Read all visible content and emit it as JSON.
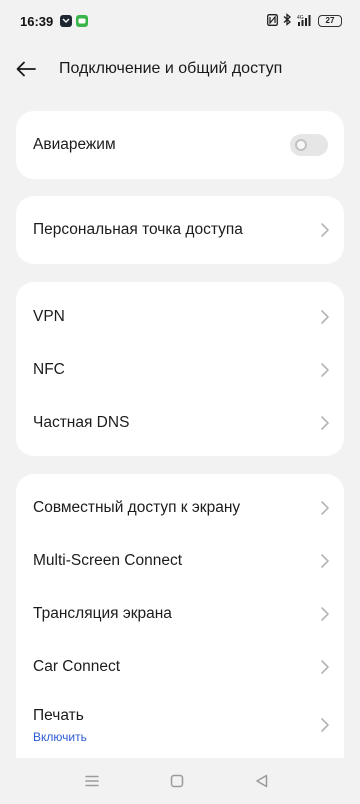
{
  "status_bar": {
    "time": "16:39",
    "battery": "27",
    "icons": [
      "notification-app-icon",
      "message-app-icon",
      "nfc-icon",
      "bluetooth-icon",
      "signal-icon",
      "battery-icon"
    ]
  },
  "header": {
    "title": "Подключение и общий доступ",
    "back_icon": "arrow-left-icon"
  },
  "airplane": {
    "label": "Авиарежим",
    "enabled": false
  },
  "hotspot": {
    "label": "Персональная точка доступа"
  },
  "network": {
    "vpn": "VPN",
    "nfc": "NFC",
    "private_dns": "Частная DNS"
  },
  "sharing": {
    "screen_share": "Совместный доступ к экрану",
    "multi_screen": "Multi-Screen Connect",
    "cast": "Трансляция экрана",
    "car_connect": "Car Connect",
    "print": "Печать",
    "print_sub": "Включить"
  },
  "nav": {
    "icons": [
      "menu-icon",
      "home-icon",
      "back-icon"
    ]
  }
}
